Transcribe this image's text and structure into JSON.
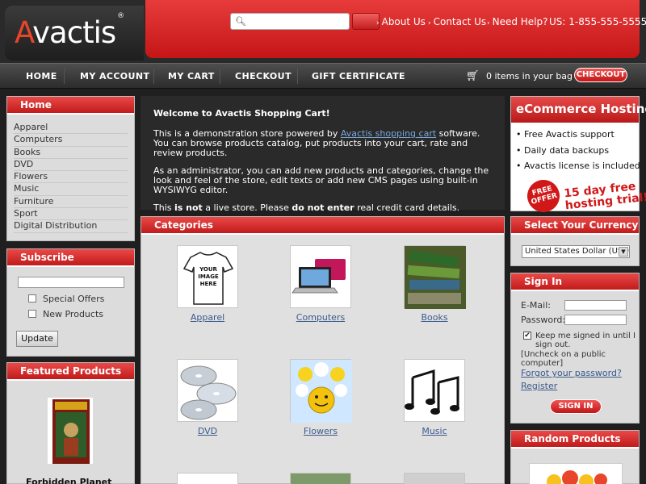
{
  "header": {
    "logo_text": "Avactis",
    "search_placeholder": "",
    "links": [
      "About Us",
      "Contact Us",
      "Need Help?"
    ],
    "phone": "US: 1-855-555-5555"
  },
  "nav": {
    "items": [
      "HOME",
      "MY ACCOUNT",
      "MY CART",
      "CHECKOUT",
      "GIFT CERTIFICATE"
    ],
    "cart_text": "0 items in your bag",
    "checkout_button": "CHECKOUT"
  },
  "home_panel": {
    "title": "Home",
    "items": [
      "Apparel",
      "Computers",
      "Books",
      "DVD",
      "Flowers",
      "Music",
      "Furniture",
      "Sport",
      "Digital Distribution"
    ]
  },
  "subscribe": {
    "title": "Subscribe",
    "options": [
      "Special Offers",
      "New Products"
    ],
    "button": "Update"
  },
  "featured": {
    "title": "Featured Products",
    "product_name": "Forbidden Planet"
  },
  "welcome": {
    "title": "Welcome to Avactis Shopping Cart!",
    "p1_pre": "This is a demonstration store powered by ",
    "p1_link": "Avactis shopping cart",
    "p1_post": " software. You can browse products catalog, put products into your cart, rate and review products.",
    "p2": "As an administrator, you can add new products and categories, change the look and feel of the store, edit texts or add new CMS pages using built-in WYSIWYG editor.",
    "p3_a": "This ",
    "p3_b": "is not",
    "p3_c": " a live store. Please ",
    "p3_d": "do not enter",
    "p3_e": " real credit card details."
  },
  "categories": {
    "title": "Categories",
    "items": [
      {
        "label": "Apparel",
        "image_text": "YOUR IMAGE HERE"
      },
      {
        "label": "Computers"
      },
      {
        "label": "Books"
      },
      {
        "label": "DVD"
      },
      {
        "label": "Flowers"
      },
      {
        "label": "Music"
      }
    ]
  },
  "ecommerce_banner": {
    "title": "eCommerce Hosting",
    "items": [
      "• Free Avactis support",
      "• Daily data backups",
      "• Avactis license is included"
    ],
    "badge": "FREE OFFER",
    "trial_line1": "15 day free",
    "trial_line2": "hosting trial!"
  },
  "currency": {
    "title": "Select Your Currency",
    "selected": "United States Dollar (USD)"
  },
  "signin": {
    "title": "Sign In",
    "email_label": "E-Mail:",
    "password_label": "Password:",
    "keep_signed": "Keep me signed in until I sign out.",
    "uncheck_note": "[Uncheck on a public computer]",
    "forgot_link": "Forgot your password?",
    "register_link": "Register",
    "button": "SIGN IN"
  },
  "random": {
    "title": "Random Products"
  }
}
